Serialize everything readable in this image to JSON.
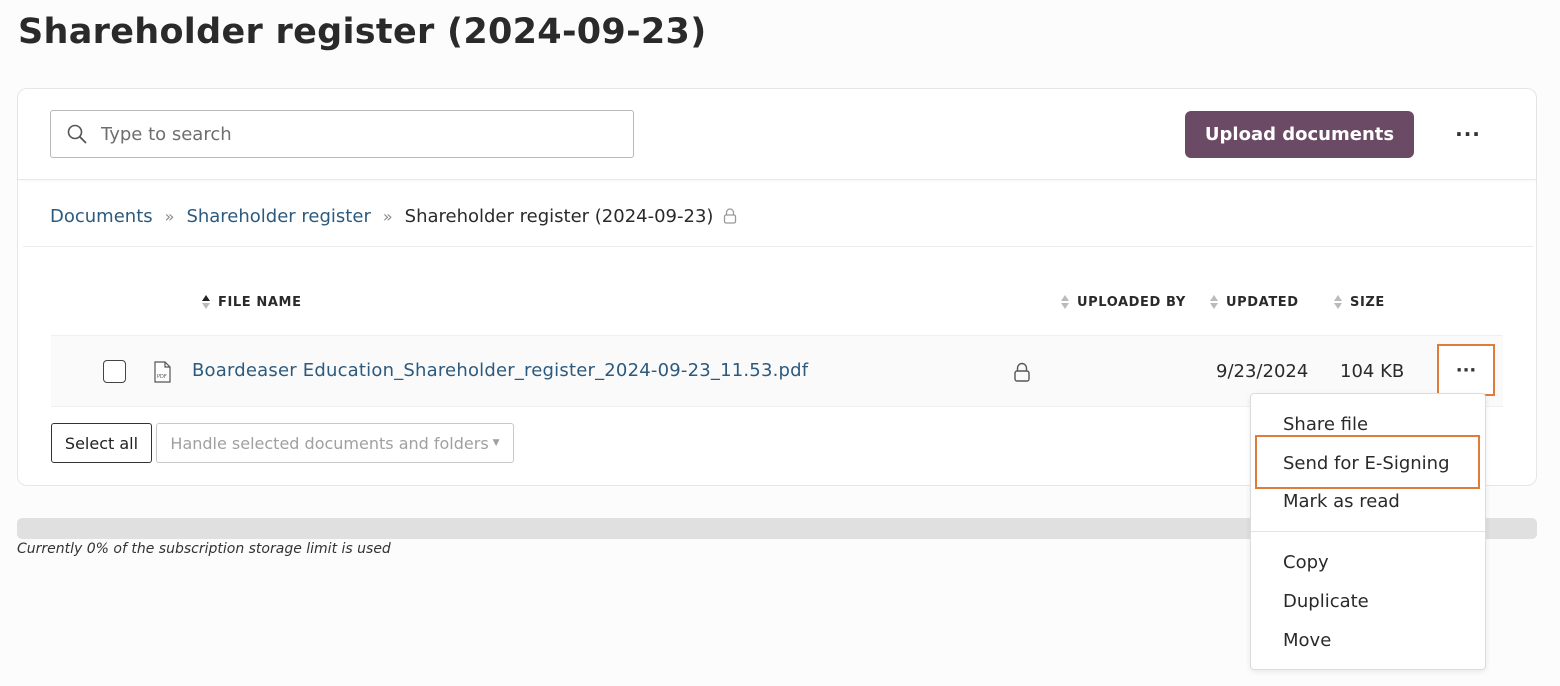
{
  "page": {
    "title": "Shareholder register (2024-09-23)"
  },
  "toolbar": {
    "search_placeholder": "Type to search",
    "upload_label": "Upload documents",
    "more_label": "···"
  },
  "breadcrumb": {
    "items": [
      "Documents",
      "Shareholder register"
    ],
    "current": "Shareholder register (2024-09-23)",
    "separator": "»"
  },
  "table": {
    "headers": {
      "file_name": "FILE NAME",
      "uploaded_by": "UPLOADED BY",
      "updated": "UPDATED",
      "size": "SIZE"
    },
    "rows": [
      {
        "file_name": "Boardeaser Education_Shareholder_register_2024-09-23_11.53.pdf",
        "uploaded_by": "",
        "updated": "9/23/2024",
        "size": "104 KB",
        "more_label": "···"
      }
    ]
  },
  "bulk_actions": {
    "select_all": "Select all",
    "handle_selected": "Handle selected documents and folders"
  },
  "storage": {
    "used_percent": 0,
    "text": "Currently 0% of the subscription storage limit is used"
  },
  "context_menu": {
    "items": [
      "Share file",
      "Send for E-Signing",
      "Mark as read",
      "Copy",
      "Duplicate",
      "Move"
    ]
  },
  "colors": {
    "accent": "#6b4a66",
    "link": "#2c5a7e",
    "highlight": "#e07b39"
  }
}
